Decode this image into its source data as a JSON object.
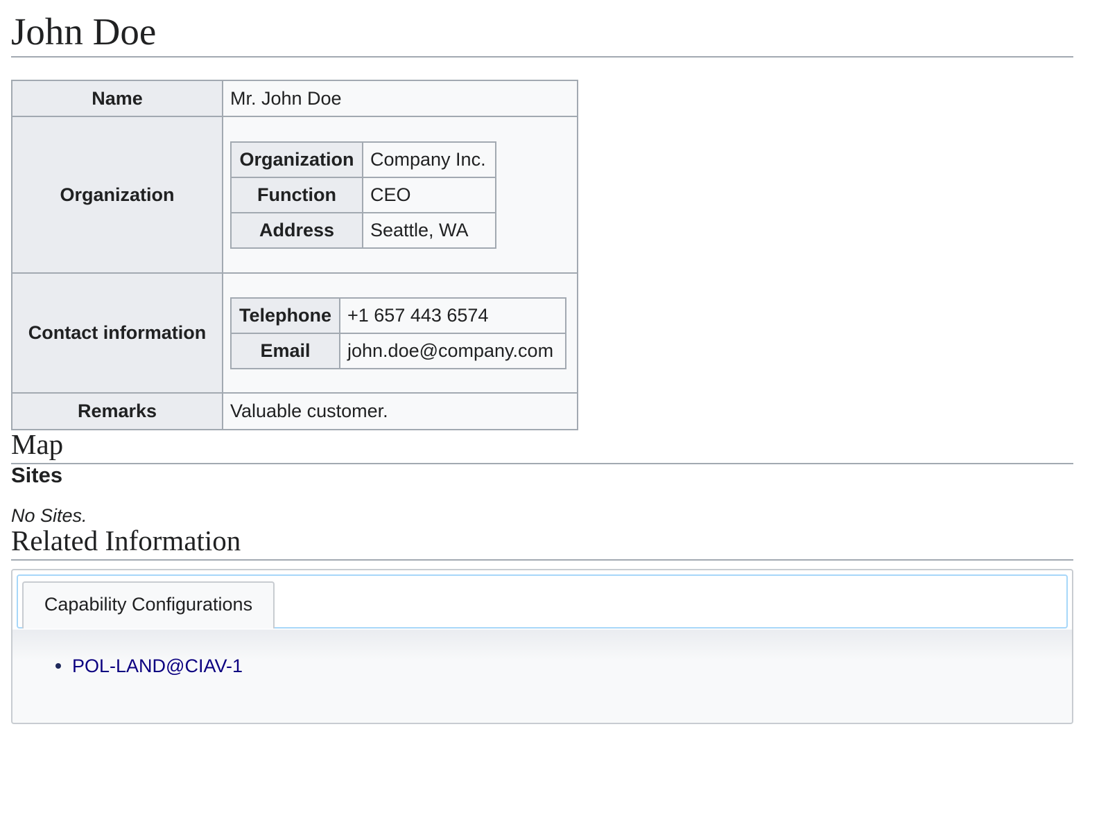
{
  "page": {
    "title": "John Doe"
  },
  "infobox": {
    "name_label": "Name",
    "name_value": "Mr. John Doe",
    "organization_label": "Organization",
    "organization": {
      "rows": [
        {
          "label": "Organization",
          "value": "Company Inc."
        },
        {
          "label": "Function",
          "value": "CEO"
        },
        {
          "label": "Address",
          "value": "Seattle, WA"
        }
      ]
    },
    "contact_label": "Contact information",
    "contact": {
      "rows": [
        {
          "label": "Telephone",
          "value": "+1 657 443 6574"
        },
        {
          "label": "Email",
          "value": "john.doe@company.com"
        }
      ]
    },
    "remarks_label": "Remarks",
    "remarks_value": "Valuable customer."
  },
  "map": {
    "heading": "Map",
    "sites_heading": "Sites",
    "no_sites_text": "No Sites."
  },
  "related": {
    "heading": "Related Information",
    "tabs": [
      {
        "label": "Capability Configurations"
      }
    ],
    "items": [
      {
        "label": "POL-LAND@CIAV-1"
      }
    ]
  },
  "colors": {
    "link": "#0b0080",
    "border": "#a2a9b1",
    "header_bg": "#eaecf0",
    "cell_bg": "#f8f9fa",
    "tab_nav_border": "#a7d7f9"
  }
}
